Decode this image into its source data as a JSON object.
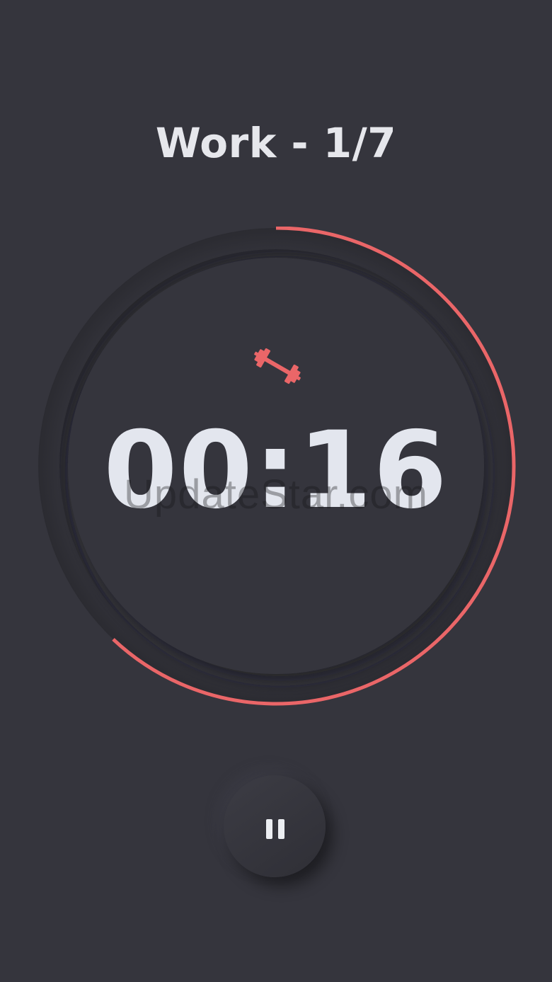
{
  "header": {
    "title": "Work - 1/7"
  },
  "timer": {
    "time": "00:16",
    "progress": 0.62
  },
  "watermark": {
    "text": "UpdateStar.com"
  },
  "icons": {
    "activity": "dumbbell-icon",
    "control": "pause-icon"
  },
  "colors": {
    "background": "#35353d",
    "accent": "#ea6668",
    "text": "#e3e6ee"
  }
}
